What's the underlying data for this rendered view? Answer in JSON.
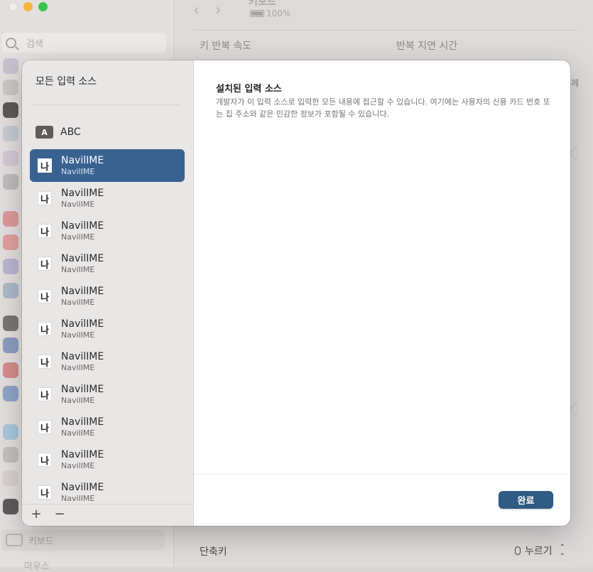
{
  "background": {
    "search_placeholder": "검색",
    "window_title": "키보드",
    "battery_percent": "100%",
    "labels": {
      "key_repeat": "키 반복 속도",
      "repeat_delay": "반복 지연 시간",
      "shortcuts": "단축키",
      "dictation_shortcut": "누르기",
      "right_edge_text": "께"
    },
    "sidebar_bottom": {
      "keyboard": "키보드",
      "mouse": "마우스"
    },
    "icon_colors": [
      "#c8c2cf",
      "#cdc8c8",
      "#5d5a5a",
      "#c6ccd4",
      "#d4c8d4",
      "#bfbcbc",
      "#dd9a9a",
      "#e2a0a0",
      "#b9b6d0",
      "#aeb8c9",
      "#7a7676",
      "#8d9cc0",
      "#d58c8c",
      "#8fa5c8",
      "#a9c7dd",
      "#c5c0c0",
      "#dad0d0",
      "#5e5b5b"
    ]
  },
  "modal": {
    "sidebar_title": "모든 입력 소스",
    "abc_source": {
      "icon": "A",
      "label": "ABC"
    },
    "input_sources": [
      {
        "icon": "나",
        "name": "NavilIME",
        "subtitle": "NavilIME",
        "selected": true
      },
      {
        "icon": "나",
        "name": "NavilIME",
        "subtitle": "NavilIME",
        "selected": false
      },
      {
        "icon": "나",
        "name": "NavilIME",
        "subtitle": "NavilIME",
        "selected": false
      },
      {
        "icon": "나",
        "name": "NavilIME",
        "subtitle": "NavilIME",
        "selected": false
      },
      {
        "icon": "나",
        "name": "NavilIME",
        "subtitle": "NavilIME",
        "selected": false
      },
      {
        "icon": "나",
        "name": "NavilIME",
        "subtitle": "NavilIME",
        "selected": false
      },
      {
        "icon": "나",
        "name": "NavilIME",
        "subtitle": "NavilIME",
        "selected": false
      },
      {
        "icon": "나",
        "name": "NavilIME",
        "subtitle": "NavilIME",
        "selected": false
      },
      {
        "icon": "나",
        "name": "NavilIME",
        "subtitle": "NavilIME",
        "selected": false
      },
      {
        "icon": "나",
        "name": "NavilIME",
        "subtitle": "NavilIME",
        "selected": false
      },
      {
        "icon": "나",
        "name": "NavilIME",
        "subtitle": "NavilIME",
        "selected": false
      }
    ],
    "add_button": "+",
    "remove_button": "−",
    "content_title": "설치된 입력 소스",
    "content_description": "개발자가 이 입력 소스로 입력한 모든 내용에 접근할 수 있습니다. 여기에는 사용자의 신용 카드 번호 또는 집 주소와 같은 민감한 정보가 포함될 수 있습니다.",
    "done_button": "완료"
  },
  "colors": {
    "selection": "#3a6291",
    "done_button": "#2f5b84",
    "traffic_close": "#ededed",
    "traffic_minimize": "#f5b640",
    "traffic_zoom": "#39c449"
  }
}
